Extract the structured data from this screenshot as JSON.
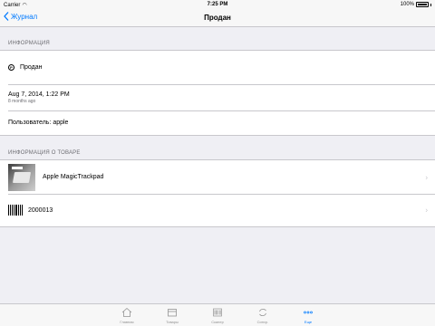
{
  "status": {
    "carrier": "Carrier",
    "time": "7:25 PM",
    "battery": "100%"
  },
  "nav": {
    "back_label": "Журнал",
    "title": "Продан"
  },
  "info_section": {
    "header": "ИНФОРМАЦИЯ",
    "status_icon_glyph": "P",
    "status_text": "Продан",
    "date": "Aug 7, 2014, 1:22 PM",
    "date_relative": "8 months ago",
    "user": "Пользователь: apple"
  },
  "product_section": {
    "header": "ИНФОРМАЦИЯ О ТОВАРЕ",
    "product_name": "Apple MagicTrackpad",
    "barcode": "2000013"
  },
  "tabs": [
    {
      "label": "Главная",
      "icon": "home-icon"
    },
    {
      "label": "Товары",
      "icon": "products-icon"
    },
    {
      "label": "Сканер",
      "icon": "scanner-icon"
    },
    {
      "label": "Синхр.",
      "icon": "sync-icon"
    },
    {
      "label": "Еще",
      "icon": "more-icon",
      "active": true
    }
  ],
  "colors": {
    "accent": "#007aff",
    "background": "#efeff4",
    "separator": "#c8c7cc"
  }
}
